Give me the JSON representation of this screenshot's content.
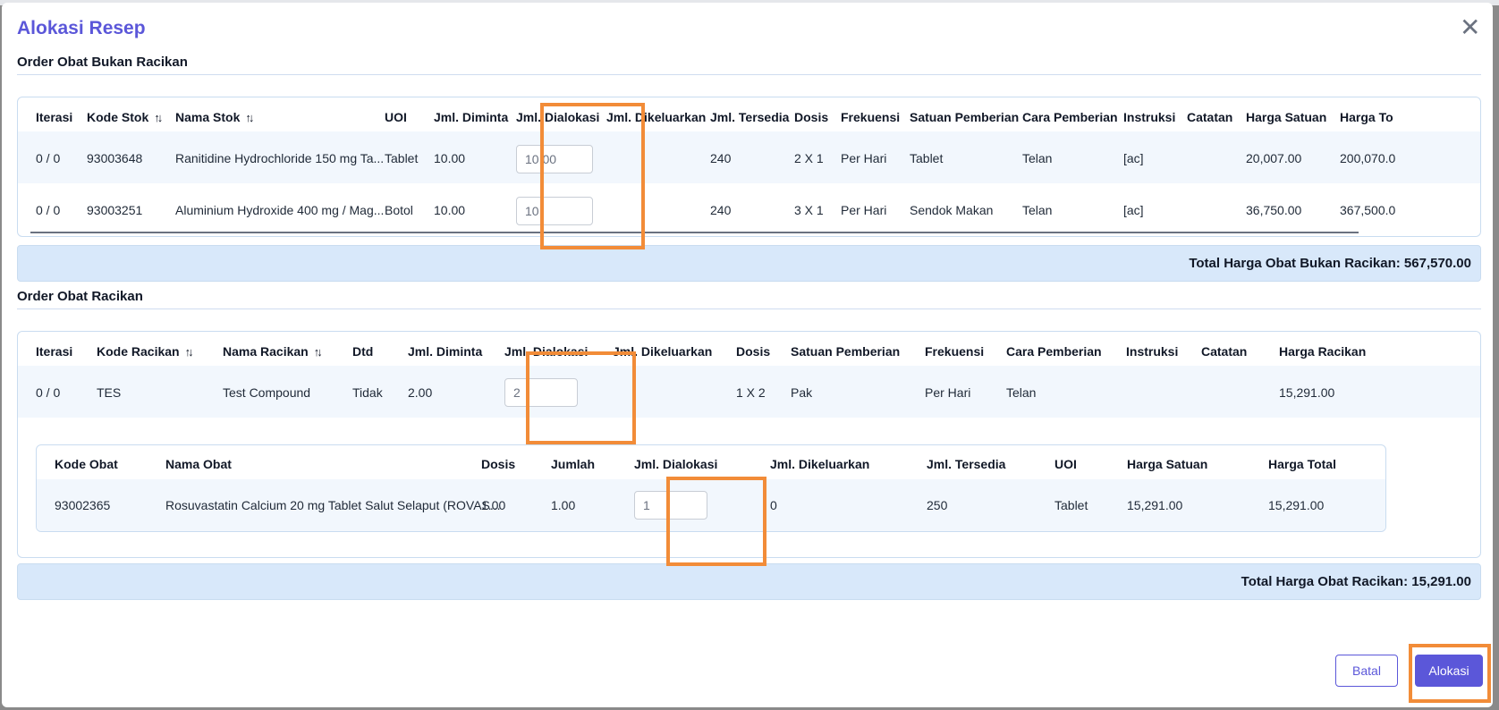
{
  "modal": {
    "title": "Alokasi Resep",
    "close_icon": "close-icon"
  },
  "non_compound": {
    "section_title": "Order Obat Bukan Racikan",
    "headers": [
      "Iterasi",
      "Kode Stok",
      "Nama Stok",
      "UOI",
      "Jml. Diminta",
      "Jml. Dialokasi",
      "Jml. Dikeluarkan",
      "Jml. Tersedia",
      "Dosis",
      "Frekuensi",
      "Satuan Pemberian",
      "Cara Pemberian",
      "Instruksi",
      "Catatan",
      "Harga Satuan",
      "Harga To"
    ],
    "rows": [
      {
        "iterasi": "0 / 0",
        "kode": "93003648",
        "nama": "Ranitidine Hydrochloride 150 mg Ta...",
        "uoi": "Tablet",
        "diminta": "10.00",
        "dialokasi": "10.00",
        "dikeluarkan": "",
        "tersedia": "240",
        "dosis": "2 X 1",
        "frekuensi": "Per Hari",
        "satuan": "Tablet",
        "cara": "Telan",
        "instruksi": "[ac]",
        "catatan": "",
        "harga_satuan": "20,007.00",
        "harga_total": "200,070.0"
      },
      {
        "iterasi": "0 / 0",
        "kode": "93003251",
        "nama": "Aluminium Hydroxide 400 mg / Mag...",
        "uoi": "Botol",
        "diminta": "10.00",
        "dialokasi": "10",
        "dikeluarkan": "",
        "tersedia": "240",
        "dosis": "3 X 1",
        "frekuensi": "Per Hari",
        "satuan": "Sendok Makan",
        "cara": "Telan",
        "instruksi": "[ac]",
        "catatan": "",
        "harga_satuan": "36,750.00",
        "harga_total": "367,500.0"
      }
    ],
    "total_label": "Total Harga Obat Bukan Racikan: 567,570.00"
  },
  "compound": {
    "section_title": "Order Obat Racikan",
    "headers": [
      "Iterasi",
      "Kode Racikan",
      "Nama Racikan",
      "Dtd",
      "Jml. Diminta",
      "Jml. Dialokasi",
      "Jml. Dikeluarkan",
      "Dosis",
      "Satuan Pemberian",
      "Frekuensi",
      "Cara Pemberian",
      "Instruksi",
      "Catatan",
      "Harga Racikan"
    ],
    "row": {
      "iterasi": "0 / 0",
      "kode": "TES",
      "nama": "Test Compound",
      "dtd": "Tidak",
      "diminta": "2.00",
      "dialokasi": "2",
      "dikeluarkan": "",
      "dosis": "1 X 2",
      "satuan": "Pak",
      "frekuensi": "Per Hari",
      "cara": "Telan",
      "instruksi": "",
      "catatan": "",
      "harga": "15,291.00"
    },
    "detail": {
      "headers": [
        "Kode Obat",
        "Nama Obat",
        "Dosis",
        "Jumlah",
        "Jml. Dialokasi",
        "Jml. Dikeluarkan",
        "Jml. Tersedia",
        "UOI",
        "Harga Satuan",
        "Harga Total"
      ],
      "row": {
        "kode": "93002365",
        "nama": "Rosuvastatin Calcium 20 mg Tablet Salut Selaput (ROVAS...",
        "dosis": "1.00",
        "jumlah": "1.00",
        "dialokasi": "1",
        "dikeluarkan": "0",
        "tersedia": "250",
        "uoi": "Tablet",
        "harga_satuan": "15,291.00",
        "harga_total": "15,291.00"
      }
    },
    "total_label": "Total Harga Obat Racikan: 15,291.00"
  },
  "footer": {
    "cancel_label": "Batal",
    "submit_label": "Alokasi"
  },
  "colors": {
    "accent": "#5b57d9",
    "highlight": "#f28c38",
    "total_bar": "#d8e8fa",
    "row_stripe": "#f2f7fd"
  }
}
